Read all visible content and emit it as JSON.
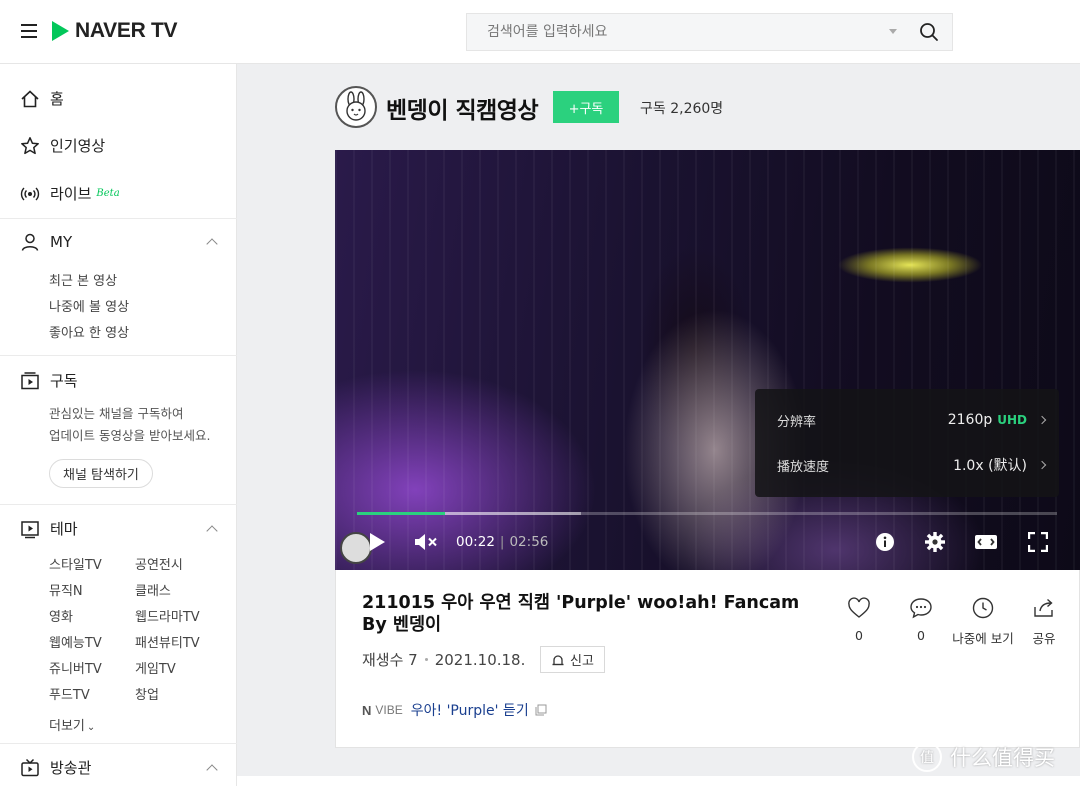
{
  "header": {
    "logo_text": "NAVER TV",
    "search_placeholder": "검색어를 입력하세요"
  },
  "sidebar": {
    "home": "홈",
    "popular": "인기영상",
    "live": "라이브",
    "live_badge": "Beta",
    "my": {
      "title": "MY",
      "items": [
        "최근 본 영상",
        "나중에 볼 영상",
        "좋아요 한 영상"
      ]
    },
    "subscribe": {
      "title": "구독",
      "desc_line1": "관심있는 채널을 구독하여",
      "desc_line2": "업데이트 동영상을 받아보세요.",
      "explore_button": "채널 탐색하기"
    },
    "theme": {
      "title": "테마",
      "items": [
        "스타일TV",
        "공연전시",
        "뮤직N",
        "클래스",
        "영화",
        "웹드라마TV",
        "웹예능TV",
        "패션뷰티TV",
        "쥬니버TV",
        "게임TV",
        "푸드TV",
        "창업"
      ],
      "more": "더보기"
    },
    "broadcast": {
      "title": "방송관"
    }
  },
  "channel": {
    "name": "벤뎅이 직캠영상",
    "subscribe_button": "+구독",
    "subscriber_count": "구독 2,260명"
  },
  "player": {
    "current_time": "00:22",
    "duration": "02:56",
    "progress_fraction": 0.125,
    "buffered_fraction": 0.32,
    "settings": {
      "resolution_label": "分辨率",
      "resolution_value": "2160p",
      "resolution_badge": "UHD",
      "speed_label": "播放速度",
      "speed_value": "1.0x (默认)"
    }
  },
  "video": {
    "title": "211015 우아 우연 직캠 'Purple' woo!ah! Fancam By 벤뎅이",
    "views": "재생수 7",
    "date": "2021.10.18.",
    "report_button": "신고",
    "actions": {
      "like_count": "0",
      "comment_count": "0",
      "watch_later": "나중에 보기",
      "share": "공유"
    },
    "vibe": {
      "badge_n": "N",
      "badge_text": "VIBE",
      "song_link": "우아! 'Purple' 듣기"
    }
  },
  "watermark": {
    "text": "什么值得买",
    "mark": "值"
  },
  "colors": {
    "brand_green": "#03c75a",
    "subscribe_green": "#2bd17e",
    "link_blue": "#1a3f8f"
  }
}
